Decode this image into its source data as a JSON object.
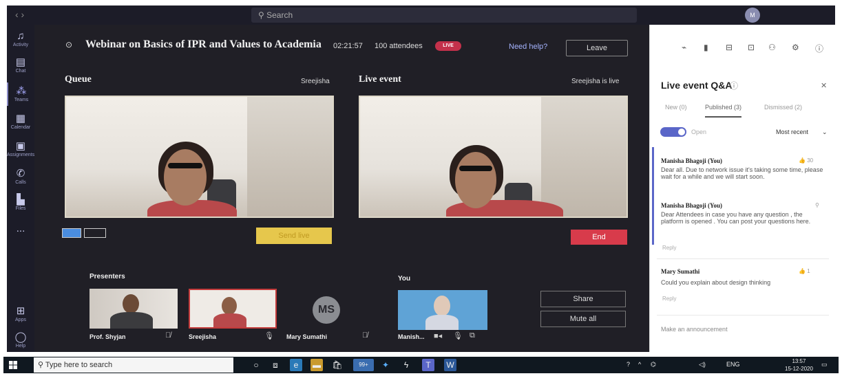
{
  "topbar": {
    "search_placeholder": "Search",
    "user_initials": "M",
    "nav_arrows": "‹ ›"
  },
  "rail": [
    {
      "label": "Activity",
      "icon": "bell-icon",
      "glyph": "🔔"
    },
    {
      "label": "Chat",
      "icon": "chat-icon",
      "glyph": "▤"
    },
    {
      "label": "Teams",
      "icon": "teams-icon",
      "glyph": "⁂"
    },
    {
      "label": "Calendar",
      "icon": "calendar-icon",
      "glyph": "▦"
    },
    {
      "label": "Assignments",
      "icon": "assignments-icon",
      "glyph": "▣"
    },
    {
      "label": "Calls",
      "icon": "phone-icon",
      "glyph": "✆"
    },
    {
      "label": "Files",
      "icon": "files-icon",
      "glyph": "▙"
    },
    {
      "label": "...",
      "icon": "more-icon",
      "glyph": ""
    },
    {
      "label": "Apps",
      "icon": "apps-icon",
      "glyph": "⊞"
    },
    {
      "label": "Help",
      "icon": "help-icon",
      "glyph": "◯"
    }
  ],
  "event": {
    "title": "Webinar on Basics of IPR and Values to Academia",
    "timer": "02:21:57",
    "attendees": "100 attendees",
    "live_badge": "LIVE",
    "help": "Need help?",
    "leave": "Leave"
  },
  "queue": {
    "label": "Queue",
    "presenter": "Sreejisha",
    "send_live": "Send live"
  },
  "live_event": {
    "label": "Live event",
    "status": "Sreejisha is live",
    "end": "End"
  },
  "presenters": {
    "label": "Presenters",
    "items": [
      {
        "name": "Prof. Shyjan"
      },
      {
        "name": "Sreejisha"
      },
      {
        "name": "Mary Sumathi",
        "initials": "MS"
      }
    ]
  },
  "you": {
    "label": "You",
    "name": "Manish..."
  },
  "side_buttons": {
    "share": "Share",
    "mute_all": "Mute all"
  },
  "qa": {
    "title": "Live event Q&A",
    "tabs": [
      "New (0)",
      "Published (3)",
      "Dismissed (2)"
    ],
    "toggle_label": "Open",
    "sort": "Most recent",
    "questions": [
      {
        "name": "Manisha Bhagoji (You)",
        "text": "Dear all. Due to network issue it's taking some time, please wait for a while and we will start soon.",
        "likes": "30"
      },
      {
        "name": "Manisha Bhagoji (You)",
        "text": "Dear Attendees in case you have any question , the platform is opened . You can post your questions here.",
        "reply": "Reply"
      },
      {
        "name": "Mary Sumathi",
        "text": "Could you explain about design thinking",
        "likes": "1",
        "reply": "Reply"
      }
    ],
    "announce": "Make an announcement"
  },
  "taskbar": {
    "search": "Type here to search",
    "badge": "99+",
    "lang": "ENG",
    "time": "13:57",
    "date": "15-12-2020"
  },
  "colors": {
    "accent": "#5a66c8",
    "live": "#c4314b",
    "end": "#d83b4b",
    "send_live": "#e6c74c"
  }
}
